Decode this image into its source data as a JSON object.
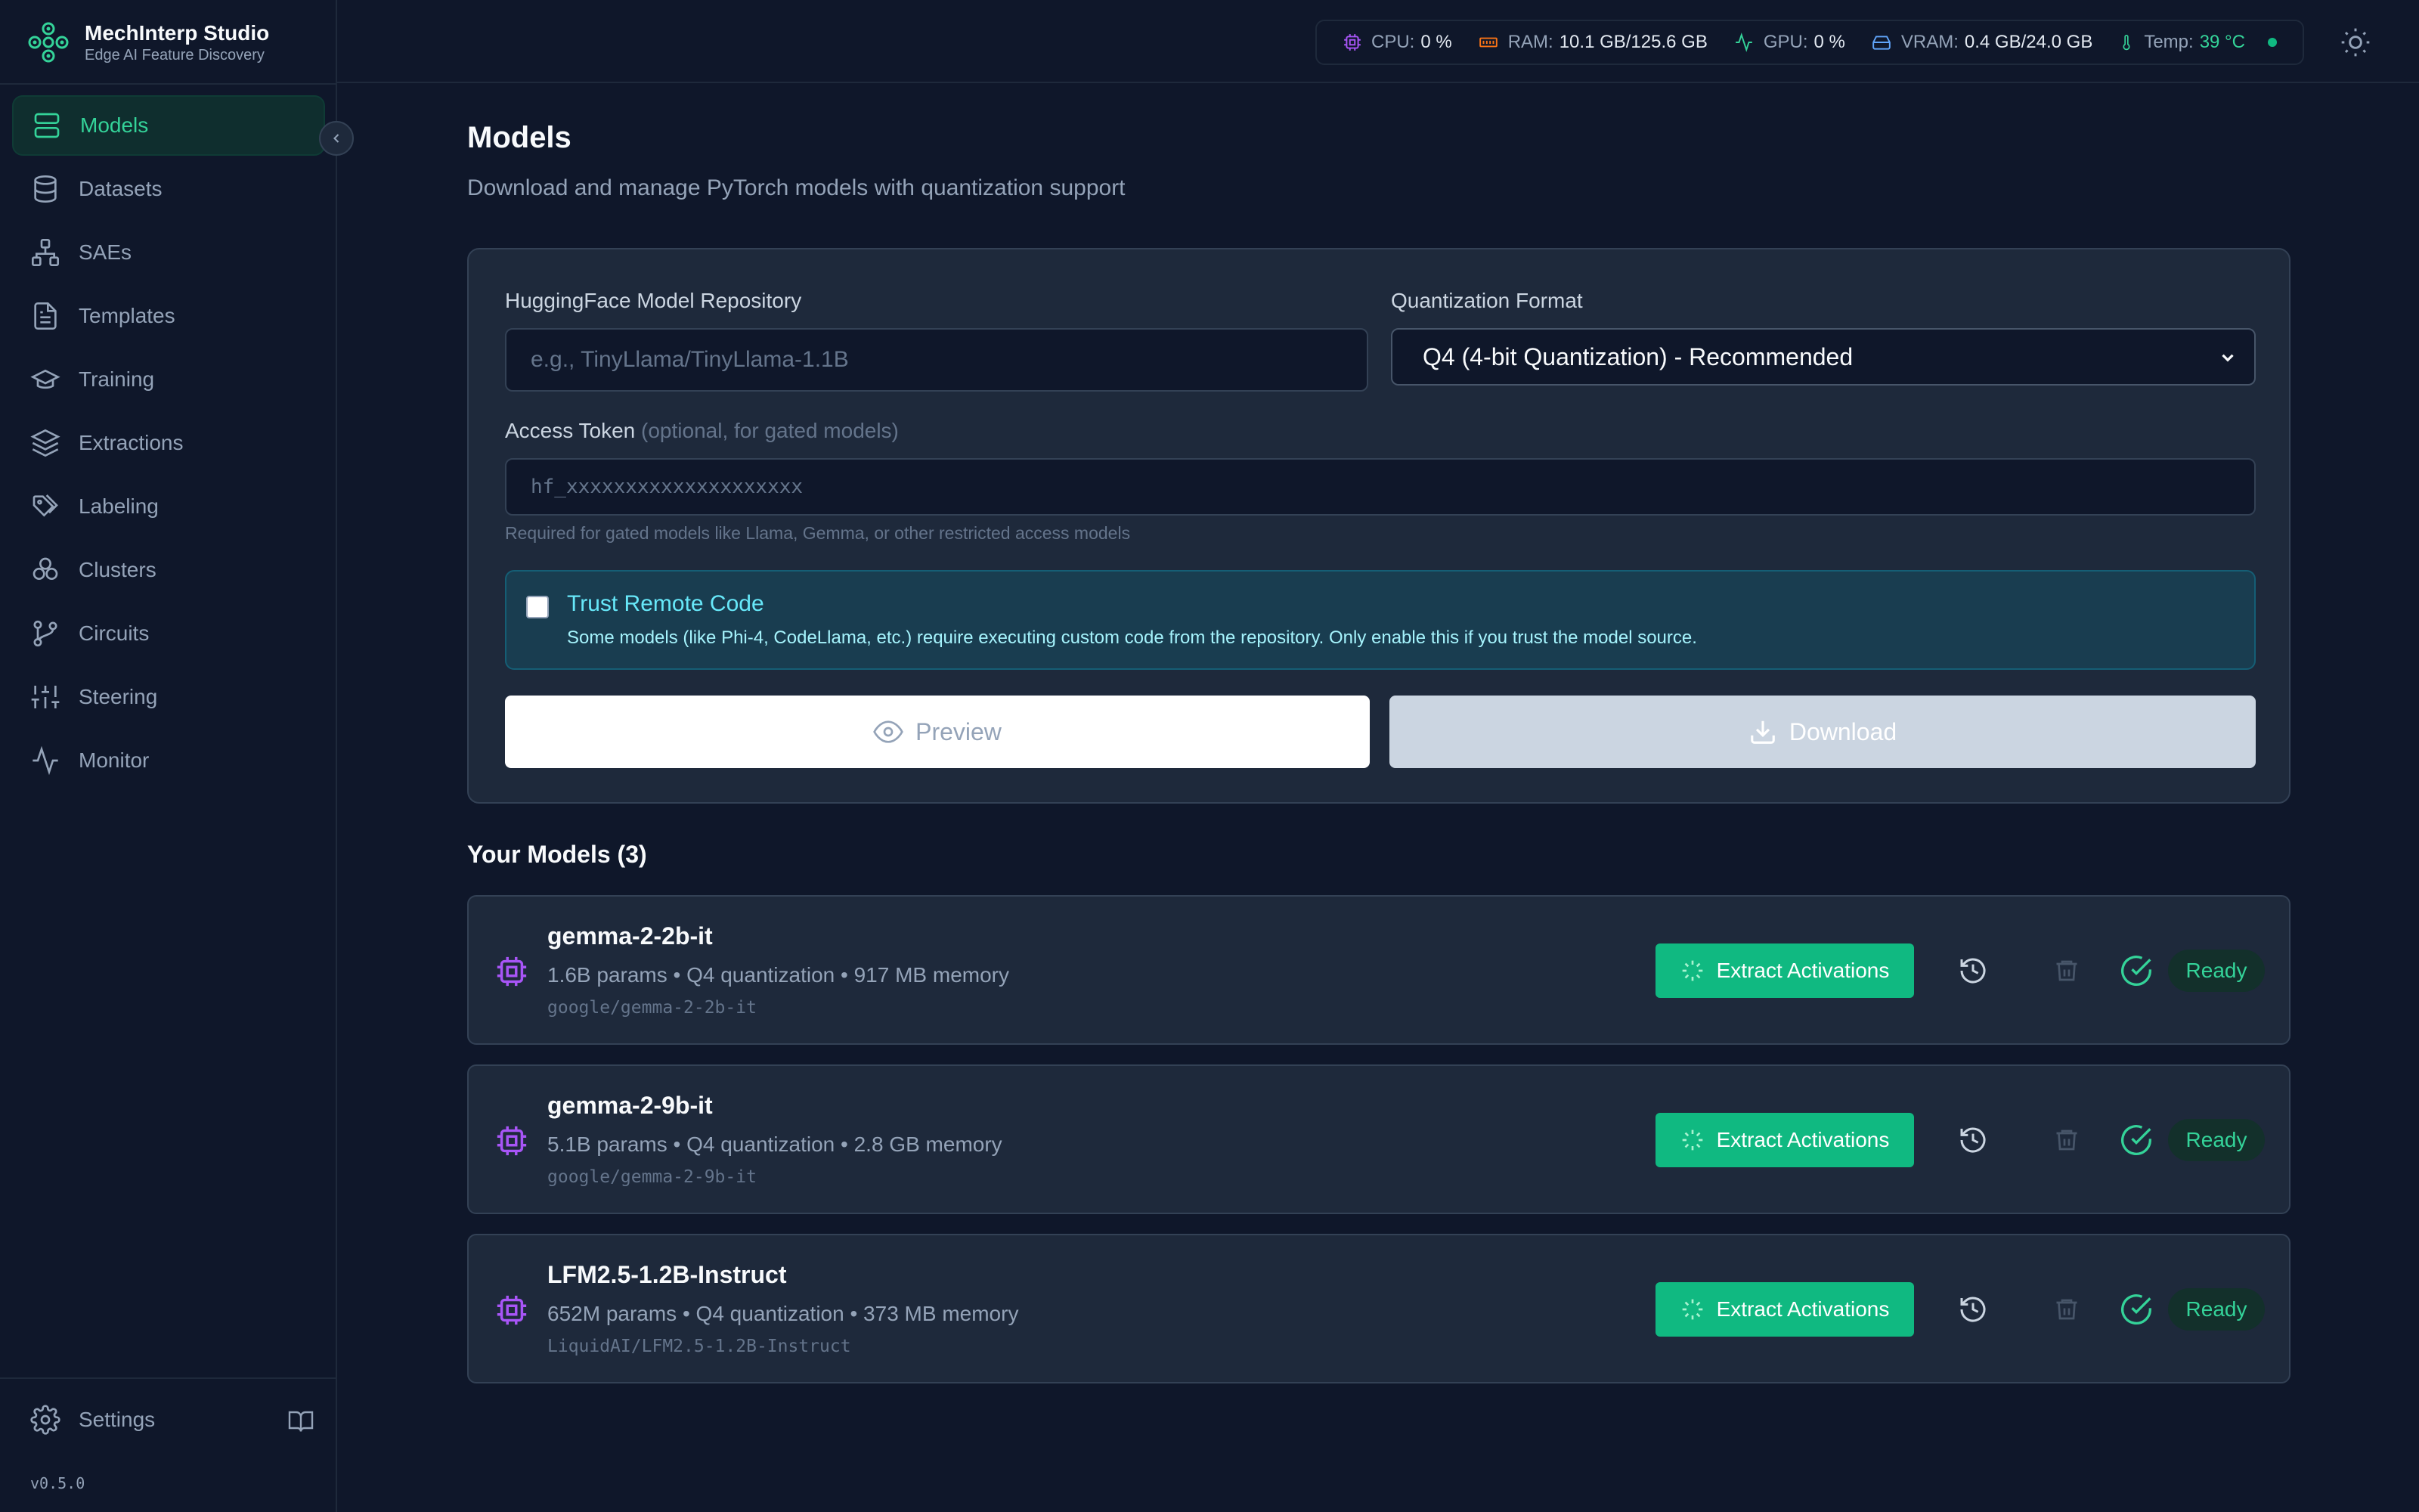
{
  "app": {
    "name": "MechInterp Studio",
    "tagline": "Edge AI Feature Discovery",
    "version": "v0.5.0"
  },
  "sidebar": {
    "items": [
      {
        "label": "Models",
        "icon": "server-icon",
        "active": true
      },
      {
        "label": "Datasets",
        "icon": "database-icon"
      },
      {
        "label": "SAEs",
        "icon": "network-icon"
      },
      {
        "label": "Templates",
        "icon": "file-text-icon"
      },
      {
        "label": "Training",
        "icon": "graduation-cap-icon"
      },
      {
        "label": "Extractions",
        "icon": "layers-icon"
      },
      {
        "label": "Labeling",
        "icon": "tags-icon"
      },
      {
        "label": "Clusters",
        "icon": "clusters-icon"
      },
      {
        "label": "Circuits",
        "icon": "git-branch-icon"
      },
      {
        "label": "Steering",
        "icon": "sliders-icon"
      },
      {
        "label": "Monitor",
        "icon": "activity-icon"
      }
    ],
    "settings_label": "Settings"
  },
  "stats": {
    "cpu_label": "CPU:",
    "cpu_value": "0 %",
    "ram_label": "RAM:",
    "ram_value": "10.1 GB/125.6 GB",
    "gpu_label": "GPU:",
    "gpu_value": "0 %",
    "vram_label": "VRAM:",
    "vram_value": "0.4 GB/24.0 GB",
    "temp_label": "Temp:",
    "temp_value": "39 °C"
  },
  "colors": {
    "accent": "#10b981",
    "chip": "#a855f7",
    "ready": "#34d399"
  },
  "page": {
    "title": "Models",
    "subtitle": "Download and manage PyTorch models with quantization support"
  },
  "form": {
    "repo_label": "HuggingFace Model Repository",
    "repo_placeholder": "e.g., TinyLlama/TinyLlama-1.1B",
    "quant_label": "Quantization Format",
    "quant_selected": "Q4 (4-bit Quantization) - Recommended",
    "token_label": "Access Token",
    "token_hint": "(optional, for gated models)",
    "token_placeholder": "hf_xxxxxxxxxxxxxxxxxxxx",
    "token_help": "Required for gated models like Llama, Gemma, or other restricted access models",
    "trust_title": "Trust Remote Code",
    "trust_desc": "Some models (like Phi-4, CodeLlama, etc.) require executing custom code from the repository. Only enable this if you trust the model source.",
    "preview_label": "Preview",
    "download_label": "Download"
  },
  "models_section": {
    "title": "Your Models (3)"
  },
  "models": [
    {
      "name": "gemma-2-2b-it",
      "meta": "1.6B params • Q4 quantization • 917 MB memory",
      "repo": "google/gemma-2-2b-it",
      "action": "Extract Activations",
      "status": "Ready"
    },
    {
      "name": "gemma-2-9b-it",
      "meta": "5.1B params • Q4 quantization • 2.8 GB memory",
      "repo": "google/gemma-2-9b-it",
      "action": "Extract Activations",
      "status": "Ready"
    },
    {
      "name": "LFM2.5-1.2B-Instruct",
      "meta": "652M params • Q4 quantization • 373 MB memory",
      "repo": "LiquidAI/LFM2.5-1.2B-Instruct",
      "action": "Extract Activations",
      "status": "Ready"
    }
  ]
}
